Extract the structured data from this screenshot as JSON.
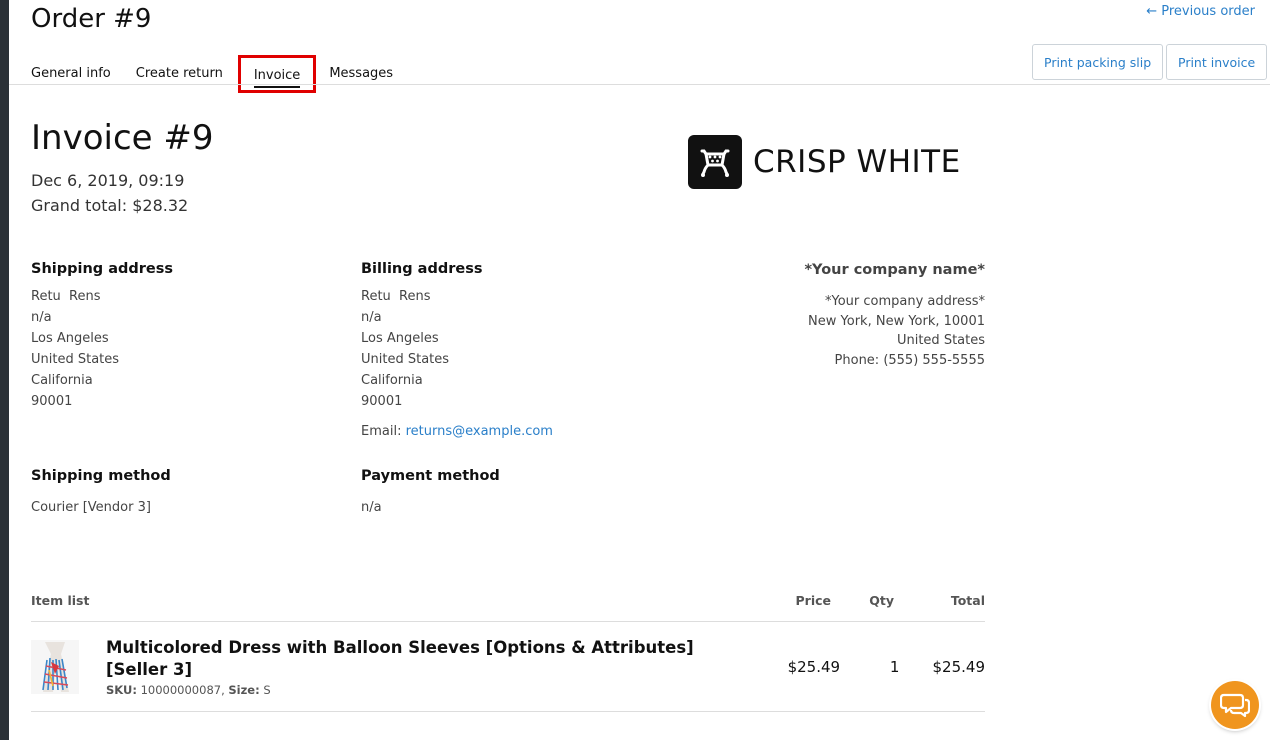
{
  "header": {
    "order_title": "Order #9",
    "previous_order": "← Previous order"
  },
  "tabs": [
    {
      "label": "General info"
    },
    {
      "label": "Create return"
    },
    {
      "label": "Invoice",
      "active": true
    },
    {
      "label": "Messages"
    }
  ],
  "buttons": {
    "print_packing_slip": "Print packing slip",
    "print_invoice": "Print invoice"
  },
  "invoice": {
    "title": "Invoice #9",
    "date": "Dec 6, 2019, 09:19",
    "grand_total": "Grand total: $28.32",
    "logo_text": "CRISP WHITE"
  },
  "shipping_address": {
    "heading": "Shipping address",
    "lines": [
      "Retu  Rens",
      "n/a",
      "Los Angeles",
      "United States",
      "California",
      "90001"
    ]
  },
  "billing_address": {
    "heading": "Billing address",
    "lines": [
      "Retu  Rens",
      "n/a",
      "Los Angeles",
      "United States",
      "California",
      "90001"
    ],
    "email_label": "Email: ",
    "email": "returns@example.com"
  },
  "company": {
    "name": "*Your company name*",
    "lines": [
      "*Your company address*",
      "New York, New York, 10001",
      "United States",
      "Phone: (555) 555-5555"
    ]
  },
  "shipping_method": {
    "heading": "Shipping method",
    "value": "Courier [Vendor 3]"
  },
  "payment_method": {
    "heading": "Payment method",
    "value": "n/a"
  },
  "items": {
    "headers": {
      "name": "Item list",
      "price": "Price",
      "qty": "Qty",
      "total": "Total"
    },
    "rows": [
      {
        "name": "Multicolored Dress with Balloon Sleeves [Options & Attributes] [Seller 3]",
        "sku_label": "SKU:",
        "sku": " 10000000087, ",
        "size_label": "Size:",
        "size": " S",
        "price": "$25.49",
        "qty": "1",
        "total": "$25.49"
      }
    ]
  },
  "colors": {
    "accent_link": "#2a7fc9",
    "active_tab_highlight": "#e00000",
    "chat_button": "#f0951e"
  },
  "icons": {
    "logo": "cart-logo-icon",
    "chat": "chat-bubbles-icon"
  }
}
